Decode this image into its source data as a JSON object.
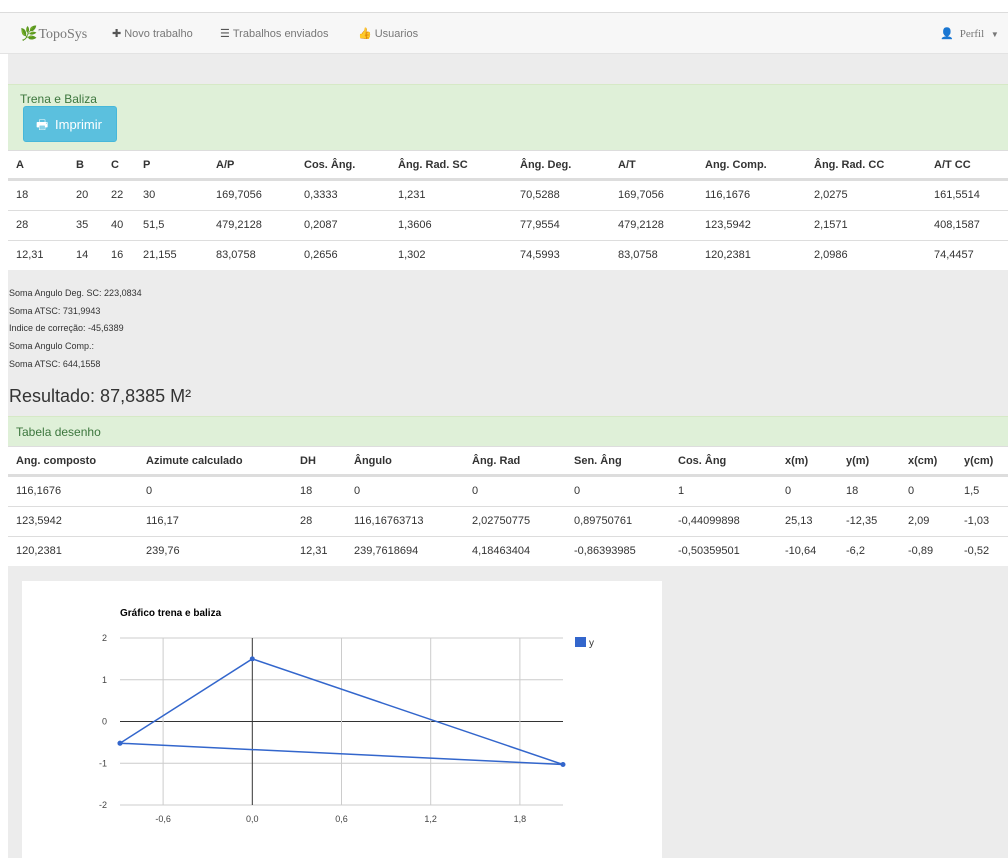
{
  "nav": {
    "brand": "TopoSys",
    "items": [
      {
        "label": "Novo trabalho",
        "icon": "plus-icon"
      },
      {
        "label": "Trabalhos enviados",
        "icon": "list-icon"
      },
      {
        "label": "Usuarios",
        "icon": "thumbs-up-icon"
      }
    ],
    "profile": "Perfil"
  },
  "panel1": {
    "title": "Trena e Baliza",
    "print_label": "Imprimir",
    "headers": [
      "A",
      "B",
      "C",
      "P",
      "A/P",
      "Cos. Âng.",
      "Âng. Rad. SC",
      "Âng. Deg.",
      "A/T",
      "Ang. Comp.",
      "Âng. Rad. CC",
      "A/T CC"
    ],
    "rows": [
      [
        "18",
        "20",
        "22",
        "30",
        "169,7056",
        "0,3333",
        "1,231",
        "70,5288",
        "169,7056",
        "116,1676",
        "2,0275",
        "161,5514"
      ],
      [
        "28",
        "35",
        "40",
        "51,5",
        "479,2128",
        "0,2087",
        "1,3606",
        "77,9554",
        "479,2128",
        "123,5942",
        "2,1571",
        "408,1587"
      ],
      [
        "12,31",
        "14",
        "16",
        "21,155",
        "83,0758",
        "0,2656",
        "1,302",
        "74,5993",
        "83,0758",
        "120,2381",
        "2,0986",
        "74,4457"
      ]
    ]
  },
  "notes": [
    "Soma Angulo Deg. SC: 223,0834",
    "Soma ATSC: 731,9943",
    "Indice de correção: -45,6389",
    "Soma Angulo Comp.:",
    "Soma ATSC: 644,1558"
  ],
  "result": "Resultado: 87,8385 M²",
  "panel2": {
    "title": "Tabela desenho",
    "headers": [
      "Ang. composto",
      "Azimute calculado",
      "DH",
      "Ângulo",
      "Âng. Rad",
      "Sen. Âng",
      "Cos. Âng",
      "x(m)",
      "y(m)",
      "x(cm)",
      "y(cm)"
    ],
    "rows": [
      [
        "116,1676",
        "0",
        "18",
        "0",
        "0",
        "0",
        "1",
        "0",
        "18",
        "0",
        "1,5"
      ],
      [
        "123,5942",
        "116,17",
        "28",
        "116,16763713",
        "2,02750775",
        "0,89750761",
        "-0,44099898",
        "25,13",
        "-12,35",
        "2,09",
        "-1,03"
      ],
      [
        "120,2381",
        "239,76",
        "12,31",
        "239,7618694",
        "4,18463404",
        "-0,86393985",
        "-0,50359501",
        "-10,64",
        "-6,2",
        "-0,89",
        "-0,52"
      ]
    ]
  },
  "chart_data": {
    "type": "line",
    "title": "Gráfico trena e baliza",
    "xlabel": "",
    "ylabel": "",
    "series": [
      {
        "name": "y",
        "color": "#3366cc",
        "x": [
          -0.89,
          0,
          2.09,
          -0.89
        ],
        "y": [
          -0.52,
          1.5,
          -1.03,
          -0.52
        ]
      }
    ],
    "xticks": [
      "-0,6",
      "0,0",
      "0,6",
      "1,2",
      "1,8"
    ],
    "yticks": [
      "2",
      "1",
      "0",
      "-1",
      "-2"
    ],
    "xlim": [
      -0.89,
      2.09
    ],
    "ylim": [
      -2,
      2
    ],
    "grid": true,
    "legend": "right"
  }
}
